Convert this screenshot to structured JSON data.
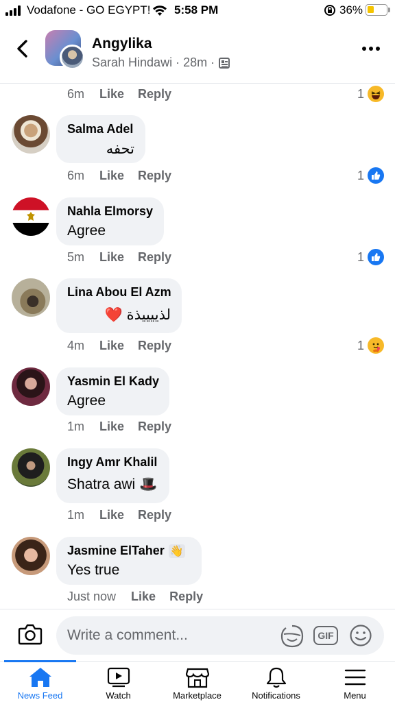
{
  "status_bar": {
    "carrier": "Vodafone - GO EGYPT!",
    "time": "5:58 PM",
    "battery": "36%",
    "battery_level": 0.36
  },
  "header": {
    "title": "Angylika",
    "subtitle_name": "Sarah Hindawi",
    "subtitle_time": "28m",
    "separator": "·"
  },
  "top_comment_meta": {
    "time": "6m",
    "like": "Like",
    "reply": "Reply",
    "reaction_count": "1",
    "reaction": "haha"
  },
  "comments": [
    {
      "name": "Salma Adel",
      "text": "تحفه",
      "time": "6m",
      "like": "Like",
      "reply": "Reply",
      "reaction_count": "1",
      "reaction": "like"
    },
    {
      "name": "Nahla Elmorsy",
      "text": "Agree",
      "time": "5m",
      "like": "Like",
      "reply": "Reply",
      "reaction_count": "1",
      "reaction": "like"
    },
    {
      "name": "Lina Abou El Azm",
      "text": "لذييييذة ❤️",
      "time": "4m",
      "like": "Like",
      "reply": "Reply",
      "reaction_count": "1",
      "reaction": "care"
    },
    {
      "name": "Yasmin El Kady",
      "text": "Agree",
      "time": "1m",
      "like": "Like",
      "reply": "Reply"
    },
    {
      "name": "Ingy Amr Khalil",
      "text": "Shatra awi 🎩",
      "time": "1m",
      "like": "Like",
      "reply": "Reply"
    },
    {
      "name": "Jasmine ElTaher",
      "text": "Yes true",
      "time": "Just now",
      "like": "Like",
      "reply": "Reply",
      "badge": "👋"
    }
  ],
  "composer": {
    "placeholder": "Write a comment...",
    "gif_label": "GIF"
  },
  "tabbar": {
    "tabs": [
      {
        "label": "News Feed",
        "icon": "home-icon",
        "active": true
      },
      {
        "label": "Watch",
        "icon": "watch-icon"
      },
      {
        "label": "Marketplace",
        "icon": "marketplace-icon"
      },
      {
        "label": "Notifications",
        "icon": "bell-icon"
      },
      {
        "label": "Menu",
        "icon": "menu-icon"
      }
    ]
  },
  "colors": {
    "accent": "#1877f2",
    "bubble": "#f0f2f5",
    "secondary_text": "#65676b"
  }
}
